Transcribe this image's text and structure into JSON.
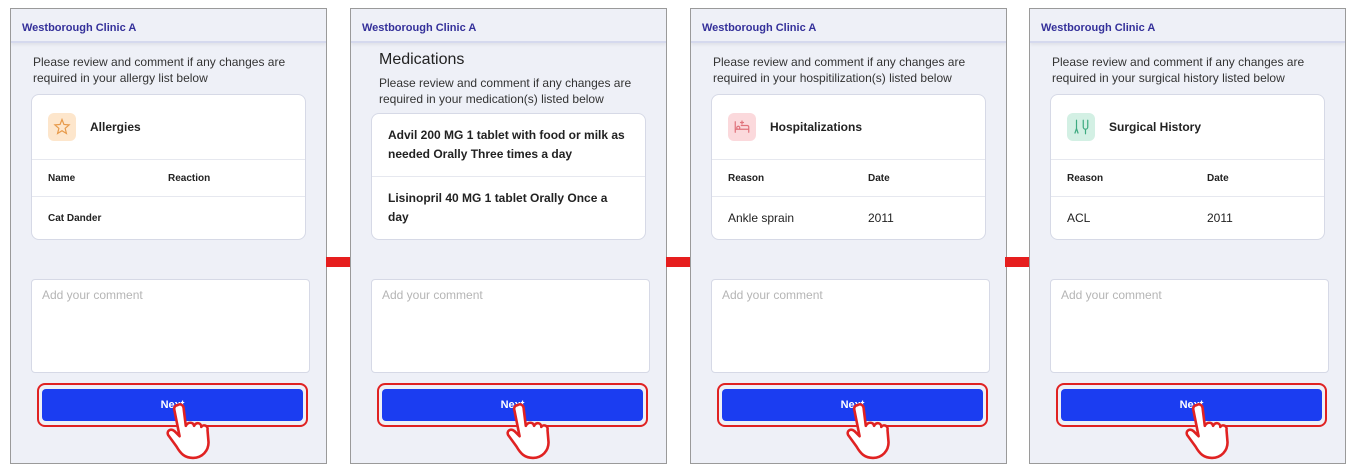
{
  "clinic_name": "Westborough Clinic A",
  "comment_placeholder": "Add your comment",
  "next_label": "Next",
  "screens": [
    {
      "intro": "Please review and comment if any changes are required in your allergy list below",
      "card_title": "Allergies",
      "icon": "star-icon",
      "columns": [
        "Name",
        "Reaction"
      ],
      "row": [
        "Cat Dander",
        ""
      ]
    },
    {
      "title": "Medications",
      "intro": "Please review and comment if any changes are required in your medication(s) listed below",
      "medications": [
        "Advil 200 MG 1 tablet with food or milk as needed Orally Three times a day",
        "Lisinopril 40 MG 1 tablet Orally Once a day"
      ]
    },
    {
      "intro": "Please review and comment if any changes are required in your hospitilization(s) listed below",
      "card_title": "Hospitalizations",
      "icon": "hospital-bed-icon",
      "columns": [
        "Reason",
        "Date"
      ],
      "row": [
        "Ankle sprain",
        "2011"
      ]
    },
    {
      "intro": "Please review and comment if any changes are required in your surgical history listed below",
      "card_title": "Surgical History",
      "icon": "surgery-icon",
      "columns": [
        "Reason",
        "Date"
      ],
      "row": [
        "ACL",
        "2011"
      ]
    }
  ],
  "colors": {
    "accent": "#1b3df1",
    "clinic_text": "#34309a",
    "highlight": "#e02222",
    "background": "#eef0f7"
  }
}
